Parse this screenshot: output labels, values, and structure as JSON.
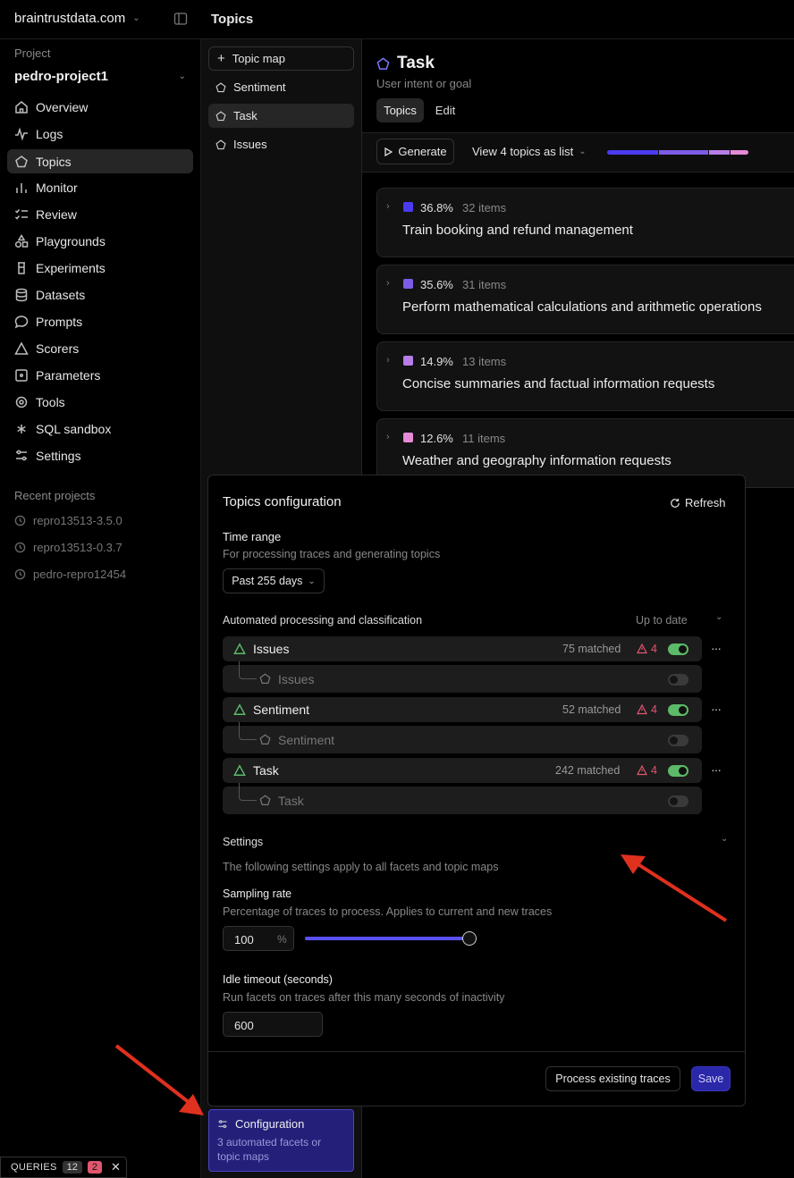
{
  "topbar": {
    "org": "braintrustdata.com",
    "page_title": "Topics"
  },
  "sidebar": {
    "project_label": "Project",
    "project_name": "pedro-project1",
    "items": [
      {
        "label": "Overview",
        "icon": "home-icon"
      },
      {
        "label": "Logs",
        "icon": "activity-icon"
      },
      {
        "label": "Topics",
        "icon": "pentagon-icon",
        "active": true
      },
      {
        "label": "Monitor",
        "icon": "bar-chart-icon"
      },
      {
        "label": "Review",
        "icon": "list-check-icon"
      },
      {
        "label": "Playgrounds",
        "icon": "shapes-icon"
      },
      {
        "label": "Experiments",
        "icon": "beaker-icon"
      },
      {
        "label": "Datasets",
        "icon": "database-icon"
      },
      {
        "label": "Prompts",
        "icon": "message-icon"
      },
      {
        "label": "Scorers",
        "icon": "triangle-icon"
      },
      {
        "label": "Parameters",
        "icon": "square-dot-icon"
      },
      {
        "label": "Tools",
        "icon": "tool-icon"
      },
      {
        "label": "SQL sandbox",
        "icon": "asterisk-icon"
      },
      {
        "label": "Settings",
        "icon": "sliders-icon"
      }
    ],
    "recent_label": "Recent projects",
    "recent": [
      "repro13513-3.5.0",
      "repro13513-0.3.7",
      "pedro-repro12454"
    ]
  },
  "topic_nav": {
    "topic_map": "Topic map",
    "items": [
      "Sentiment",
      "Task",
      "Issues"
    ],
    "config": {
      "title": "Configuration",
      "subtitle": "3 automated facets or topic maps"
    }
  },
  "queries": {
    "label": "QUERIES",
    "count": "12",
    "errors": "2"
  },
  "main": {
    "title": "Task",
    "subtitle": "User intent or goal",
    "tabs": [
      "Topics",
      "Edit"
    ],
    "generate": "Generate",
    "view_list": "View 4 topics as list",
    "topics": [
      {
        "pct": "36.8%",
        "items": "32 items",
        "title": "Train booking and refund management",
        "color": "#4b3bf0",
        "share": 0.368
      },
      {
        "pct": "35.6%",
        "items": "31 items",
        "title": "Perform mathematical calculations and arithmetic operations",
        "color": "#7c5ce6",
        "share": 0.356
      },
      {
        "pct": "14.9%",
        "items": "13 items",
        "title": "Concise summaries and factual information requests",
        "color": "#b77de8",
        "share": 0.149
      },
      {
        "pct": "12.6%",
        "items": "11 items",
        "title": "Weather and geography information requests",
        "color": "#e58ad6",
        "share": 0.126
      }
    ]
  },
  "config_panel": {
    "title": "Topics configuration",
    "refresh": "Refresh",
    "time_range_label": "Time range",
    "time_range_help": "For processing traces and generating topics",
    "time_range_value": "Past 255 days",
    "auto_label": "Automated processing and classification",
    "auto_status": "Up to date",
    "facets": [
      {
        "name": "Issues",
        "matched": "75 matched",
        "warnings": "4",
        "topic_map": "Issues"
      },
      {
        "name": "Sentiment",
        "matched": "52 matched",
        "warnings": "4",
        "topic_map": "Sentiment"
      },
      {
        "name": "Task",
        "matched": "242 matched",
        "warnings": "4",
        "topic_map": "Task"
      }
    ],
    "settings_label": "Settings",
    "settings_help": "The following settings apply to all facets and topic maps",
    "sampling_label": "Sampling rate",
    "sampling_help": "Percentage of traces to process. Applies to current and new traces",
    "sampling_value": "100",
    "sampling_unit": "%",
    "sampling_fraction": 1.0,
    "idle_label": "Idle timeout (seconds)",
    "idle_help": "Run facets on traces after this many seconds of inactivity",
    "idle_value": "600",
    "process_btn": "Process existing traces",
    "save_btn": "Save"
  },
  "colors": {
    "accent": "#5b50f0",
    "toggle_on": "#5cba68",
    "warning": "#e0566e",
    "config_bg": "#24207a"
  }
}
